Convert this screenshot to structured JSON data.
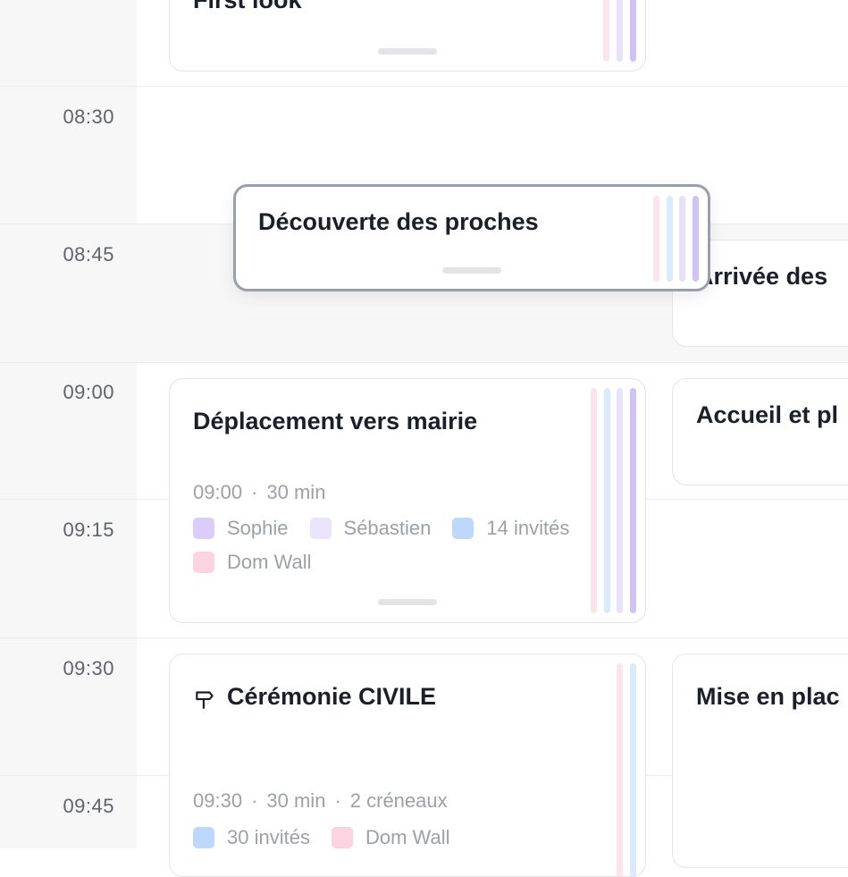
{
  "timeline": {
    "times": [
      "08:30",
      "08:45",
      "09:00",
      "09:15",
      "09:30",
      "09:45"
    ]
  },
  "colors": {
    "sophie": "#dcccfa",
    "sebastien": "#ece3fd",
    "guests": "#bdd8fb",
    "domwall": "#fbd3e1",
    "bar_purple": "#d2c1f6",
    "bar_lavender": "#e9e0fc",
    "bar_blue": "#dbe9fc",
    "bar_pink": "#fce3ec"
  },
  "events": {
    "first_look": {
      "title": "First look"
    },
    "decouverte": {
      "title": "Découverte des proches"
    },
    "arrivee": {
      "title": "Arrivée des"
    },
    "deplacement": {
      "title": "Déplacement vers mairie",
      "time": "09:00",
      "duration": "30 min",
      "people": [
        "Sophie",
        "Sébastien",
        "14 invités",
        "Dom Wall"
      ]
    },
    "accueil": {
      "title": "Accueil et pl"
    },
    "ceremonie": {
      "title": "Cérémonie CIVILE",
      "icon": "signpost-icon",
      "time": "09:30",
      "duration": "30 min",
      "slots": "2 créneaux",
      "people": [
        "30 invités",
        "Dom Wall"
      ]
    },
    "mise": {
      "title": "Mise en plac"
    }
  }
}
